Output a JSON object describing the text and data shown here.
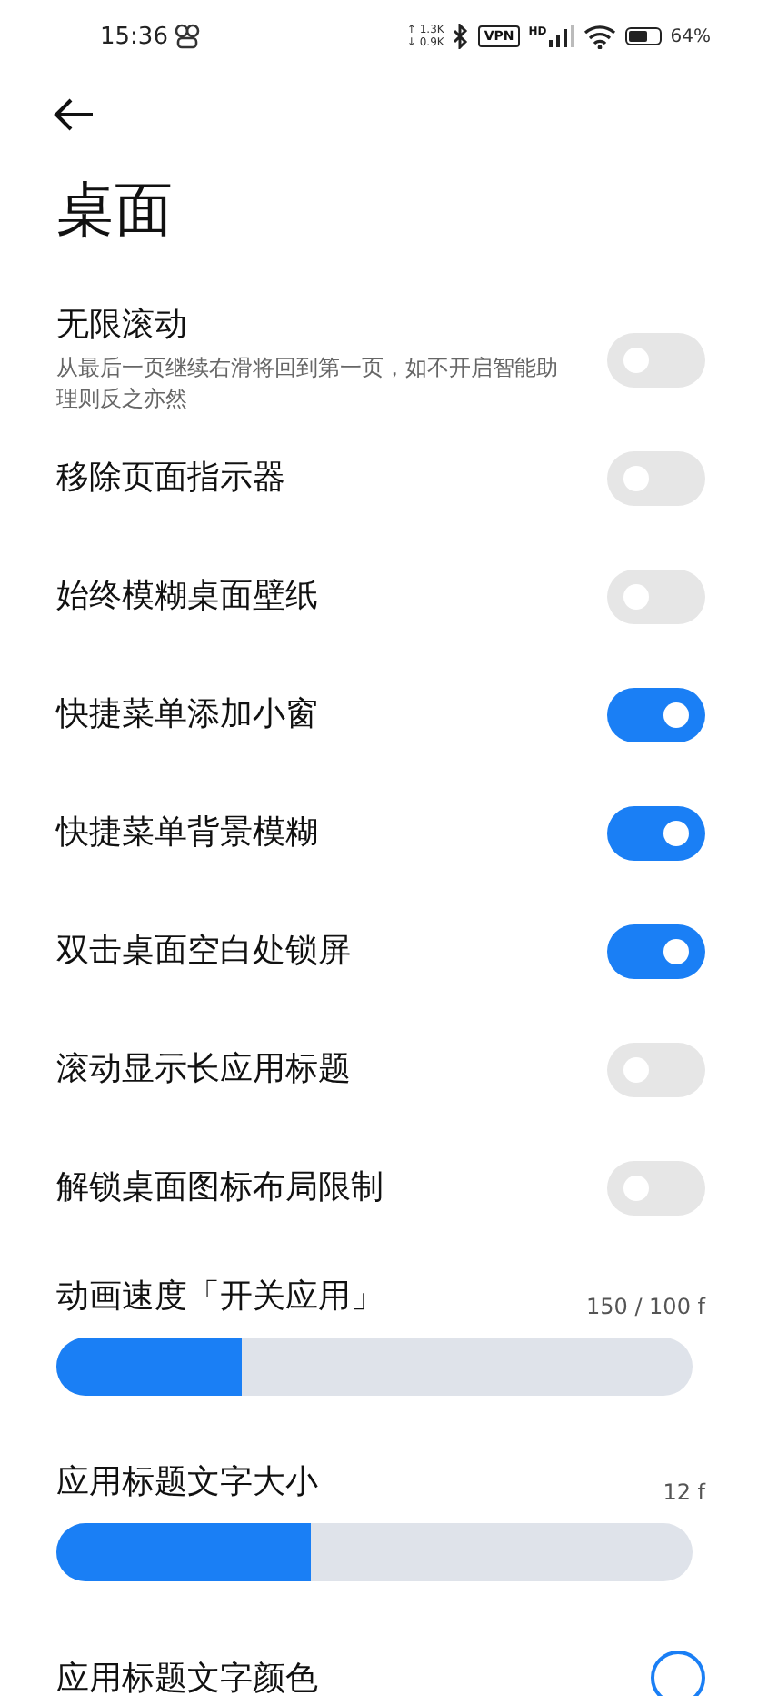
{
  "status_bar": {
    "time": "15:36",
    "upload_speed": "↑ 1.3K",
    "download_speed": "↓ 0.9K",
    "vpn": "VPN",
    "network": "HD",
    "battery": "64%"
  },
  "title": "桌面",
  "settings": [
    {
      "kind": "toggle",
      "label": "无限滚动",
      "description": "从最后一页继续右滑将回到第一页，如不开启智能助理则反之亦然",
      "on": false
    },
    {
      "kind": "toggle",
      "label": "移除页面指示器",
      "on": false
    },
    {
      "kind": "toggle",
      "label": "始终模糊桌面壁纸",
      "on": false
    },
    {
      "kind": "toggle",
      "label": "快捷菜单添加小窗",
      "on": true
    },
    {
      "kind": "toggle",
      "label": "快捷菜单背景模糊",
      "on": true
    },
    {
      "kind": "toggle",
      "label": "双击桌面空白处锁屏",
      "on": true
    },
    {
      "kind": "toggle",
      "label": "滚动显示长应用标题",
      "on": false
    },
    {
      "kind": "toggle",
      "label": "解锁桌面图标布局限制",
      "on": false
    },
    {
      "kind": "slider",
      "label": "动画速度「开关应用」",
      "reading": "150 / 100 f",
      "level": 0.29
    },
    {
      "kind": "slider",
      "label": "应用标题文字大小",
      "reading": "12 f",
      "level": 0.4
    },
    {
      "kind": "color",
      "label": "应用标题文字颜色",
      "color": "#1a7ff5"
    }
  ]
}
